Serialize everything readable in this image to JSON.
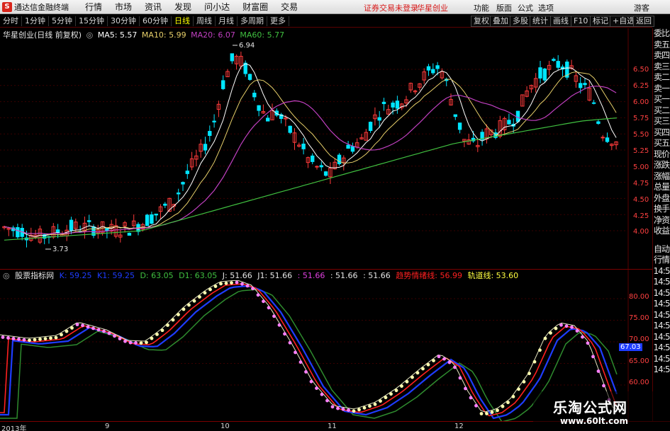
{
  "app": {
    "logo": "S",
    "title": "通达信金融终端",
    "notice": "证券交易未登录",
    "stock_top": "华星创业"
  },
  "menu": [
    "行情",
    "市场",
    "资讯",
    "发现",
    "问小达",
    "财富圈",
    "交易"
  ],
  "right_menu": [
    "功能",
    "版面",
    "公式",
    "选项"
  ],
  "guest": "游客",
  "periods": [
    "分时",
    "1分钟",
    "5分钟",
    "15分钟",
    "30分钟",
    "60分钟",
    "日线",
    "周线",
    "月线",
    "多周期",
    "更多"
  ],
  "active_period": "日线",
  "tools": [
    "复权",
    "叠加",
    "多股",
    "统计",
    "画线",
    "F10",
    "标记",
    "+自选",
    "返回"
  ],
  "legend": {
    "stock": "华星创业(日线 前复权)",
    "ma5": "MA5: 5.57",
    "ma10": "MA10: 5.99",
    "ma20": "MA20: 6.07",
    "ma60": "MA60: 5.77"
  },
  "sub_legend": {
    "name": "股票指标网",
    "k": "K: 59.25",
    "k1": "K1: 59.25",
    "d": "D: 63.05",
    "d1": "D1: 63.05",
    "j": "J: 51.66",
    "j1": "J1: 51.66",
    "v1": ": 51.66",
    "v2": ": 51.66",
    "v3": ": 51.66",
    "trend": "趋势情绪线: 56.99",
    "track": "轨道线: 53.60"
  },
  "price_axis": [
    "6.50",
    "6.25",
    "6.00",
    "5.75",
    "5.50",
    "5.25",
    "5.00",
    "4.75",
    "4.50",
    "4.25",
    "4.00"
  ],
  "sub_axis": [
    "80.00",
    "75.00",
    "70.00",
    "65.00",
    "60.00"
  ],
  "sub_current": "67.03",
  "annotations": {
    "high": "6.94",
    "low": "3.73"
  },
  "right_panel": [
    "委比",
    "卖五",
    "卖四",
    "卖三",
    "卖二",
    "卖一",
    "买一",
    "买二",
    "买三",
    "买四",
    "买五",
    "现价",
    "涨跌",
    "涨幅",
    "总量",
    "外盘",
    "换手",
    "净资",
    "收益",
    "",
    "自动",
    "行情",
    "14:5",
    "14:5",
    "14:5",
    "14:5",
    "14:5",
    "14:5",
    "14:5",
    "14:5",
    "14:5",
    "14:5"
  ],
  "dates": [
    "2013年",
    "9",
    "10",
    "11",
    "12"
  ],
  "watermark": {
    "title": "乐淘公式网",
    "url": "www.60lt.com"
  },
  "colors": {
    "up": "#ff3b3b",
    "down": "#00e5ff",
    "ma5": "#ffffff",
    "ma10": "#e8d06a",
    "ma20": "#c040c0",
    "ma60": "#40c040",
    "k": "#ff2020",
    "d": "#1e3cff",
    "j": "#ffffff"
  }
}
